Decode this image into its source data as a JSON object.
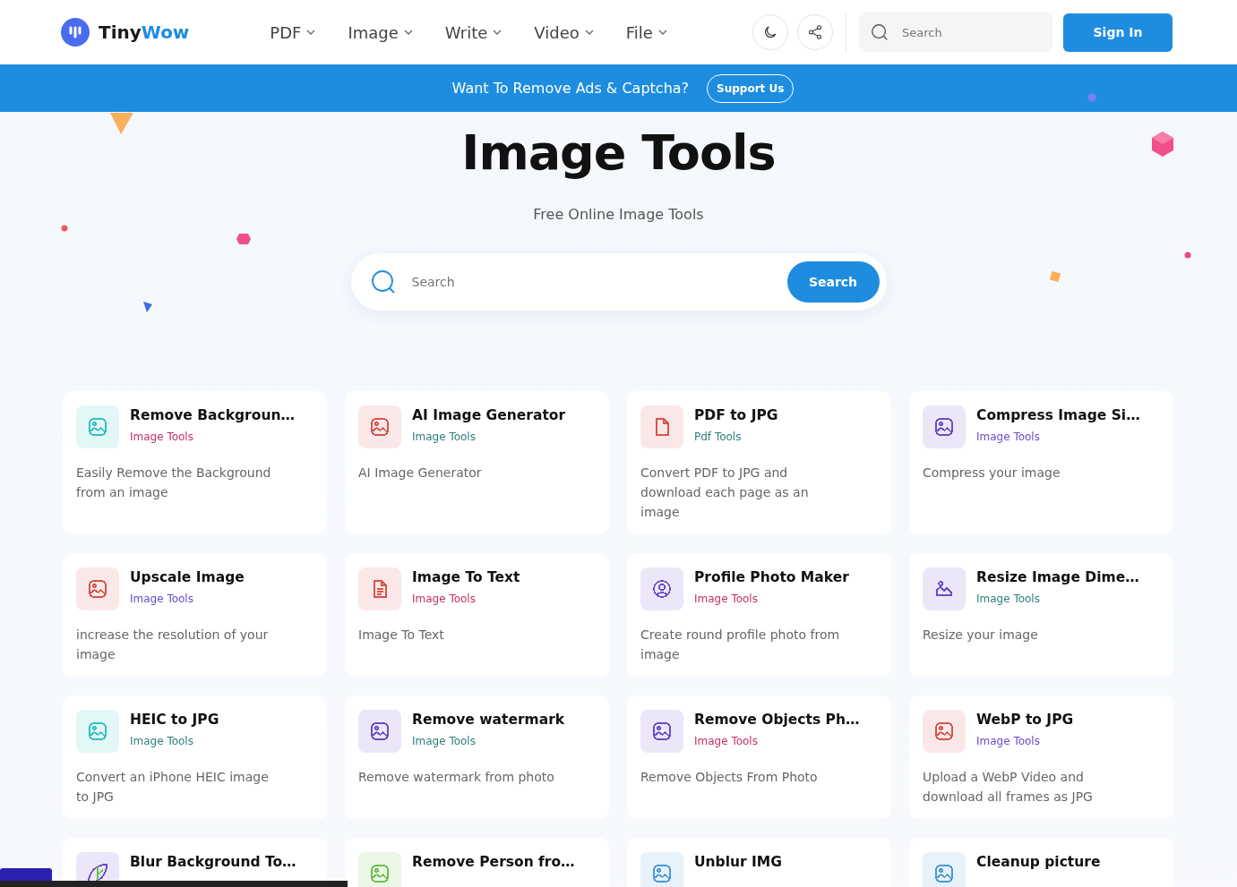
{
  "header": {
    "logo": {
      "first": "Tiny",
      "second": "Wow"
    },
    "nav": [
      {
        "label": "PDF"
      },
      {
        "label": "Image"
      },
      {
        "label": "Write"
      },
      {
        "label": "Video"
      },
      {
        "label": "File"
      }
    ],
    "search": {
      "placeholder": "Search"
    },
    "sign_in": "Sign In"
  },
  "banner": {
    "text": "Want To Remove Ads & Captcha?",
    "button": "Support Us"
  },
  "hero": {
    "title": "Image Tools",
    "subtitle": "Free Online Image Tools",
    "search": {
      "placeholder": "Search",
      "button": "Search"
    }
  },
  "cards": [
    {
      "title": "Remove Backgroun…",
      "tag": {
        "label": "Image Tools",
        "color": "#c0306a"
      },
      "description": "Easily Remove the Background from an image",
      "kind": "image",
      "color": "#2fc2c2"
    },
    {
      "title": "AI Image Generator",
      "tag": {
        "label": "Image Tools",
        "color": "#2e7d7d"
      },
      "description": "AI Image Generator",
      "kind": "image",
      "color": "#d9534f"
    },
    {
      "title": "PDF to JPG",
      "tag": {
        "label": "Pdf Tools",
        "color": "#2e7d7d"
      },
      "description": "Convert PDF to JPG and download each page as an image",
      "kind": "file",
      "color": "#d9534f"
    },
    {
      "title": "Compress Image Si…",
      "tag": {
        "label": "Image Tools",
        "color": "#6a4cc7"
      },
      "description": "Compress your image",
      "kind": "image",
      "color": "#6a4cc7"
    },
    {
      "title": "Upscale Image",
      "tag": {
        "label": "Image Tools",
        "color": "#6a4cc7"
      },
      "description": "increase the resolution of your image",
      "kind": "image",
      "color": "#d9534f"
    },
    {
      "title": "Image To Text",
      "tag": {
        "label": "Image Tools",
        "color": "#c0306a"
      },
      "description": "Image To Text",
      "kind": "document",
      "color": "#d9534f"
    },
    {
      "title": "Profile Photo Maker",
      "tag": {
        "label": "Image Tools",
        "color": "#c0306a"
      },
      "description": "Create round profile photo from image",
      "kind": "profile",
      "color": "#6a4cc7"
    },
    {
      "title": "Resize Image Dime…",
      "tag": {
        "label": "Image Tools",
        "color": "#2e7d7d"
      },
      "description": "Resize your image",
      "kind": "landscape",
      "color": "#6a4cc7"
    },
    {
      "title": "HEIC to JPG",
      "tag": {
        "label": "Image Tools",
        "color": "#2e7d7d"
      },
      "description": "Convert an iPhone HEIC image to JPG",
      "kind": "image",
      "color": "#2fc2c2"
    },
    {
      "title": "Remove watermark",
      "tag": {
        "label": "Image Tools",
        "color": "#2e7d7d"
      },
      "description": "Remove watermark from photo",
      "kind": "image",
      "color": "#6a4cc7"
    },
    {
      "title": "Remove Objects Ph…",
      "tag": {
        "label": "Image Tools",
        "color": "#c0306a"
      },
      "description": "Remove Objects From Photo",
      "kind": "image",
      "color": "#6a4cc7"
    },
    {
      "title": "WebP to JPG",
      "tag": {
        "label": "Image Tools",
        "color": "#6a4cc7"
      },
      "description": "Upload a WebP Video and download all frames as JPG",
      "kind": "image",
      "color": "#d9534f"
    },
    {
      "title": "Blur Background To…",
      "kind": "leaf",
      "color": "#6a4cc7"
    },
    {
      "title": "Remove Person fro…",
      "kind": "image",
      "color": "#6cc04a"
    },
    {
      "title": "Unblur IMG",
      "kind": "image",
      "color": "#4a9ad9"
    },
    {
      "title": "Cleanup picture",
      "kind": "image",
      "color": "#4a9ad9"
    }
  ]
}
